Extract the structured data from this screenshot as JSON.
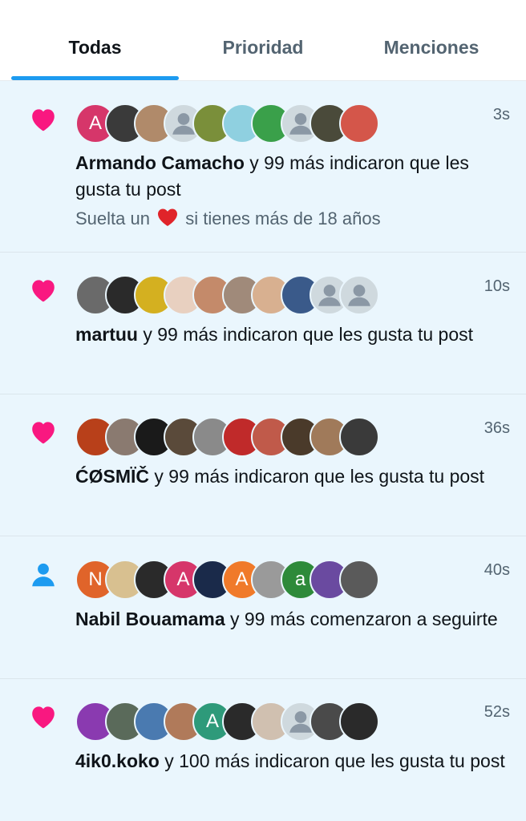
{
  "tabs": [
    {
      "label": "Todas",
      "active": true
    },
    {
      "label": "Prioridad",
      "active": false
    },
    {
      "label": "Menciones",
      "active": false
    }
  ],
  "colors": {
    "accent": "#1d9bf0",
    "like": "#f91880",
    "follow": "#1d9bf0",
    "background": "#eaf6fd"
  },
  "notifications": [
    {
      "type": "like",
      "icon": "heart-icon",
      "time": "3s",
      "name": "Armando Camacho",
      "action": "y 99 más indicaron que les gusta tu post",
      "post_preview_before": "Suelta un",
      "post_preview_emoji": "red-heart-emoji",
      "post_preview_after": "si tienes más de 18 años",
      "avatars": [
        {
          "letter": "A",
          "color": "#d6366a"
        },
        {
          "letter": "",
          "color": "#3a3a3a"
        },
        {
          "letter": "",
          "color": "#b08a6a"
        },
        {
          "letter": "",
          "color": "default"
        },
        {
          "letter": "",
          "color": "#7a8f3a"
        },
        {
          "letter": "",
          "color": "#8fd0e0"
        },
        {
          "letter": "",
          "color": "#3aa04a"
        },
        {
          "letter": "",
          "color": "default"
        },
        {
          "letter": "",
          "color": "#4a4a3a"
        },
        {
          "letter": "",
          "color": "#d4564a"
        }
      ]
    },
    {
      "type": "like",
      "icon": "heart-icon",
      "time": "10s",
      "name": "martuu",
      "action": "y 99 más indicaron que les gusta tu post",
      "avatars": [
        {
          "letter": "",
          "color": "#6a6a6a"
        },
        {
          "letter": "",
          "color": "#2a2a2a"
        },
        {
          "letter": "",
          "color": "#d4b020"
        },
        {
          "letter": "",
          "color": "#e8d0c0"
        },
        {
          "letter": "",
          "color": "#c48a6a"
        },
        {
          "letter": "",
          "color": "#a08a7a"
        },
        {
          "letter": "",
          "color": "#d8b090"
        },
        {
          "letter": "",
          "color": "#3a5a8a"
        },
        {
          "letter": "",
          "color": "default"
        },
        {
          "letter": "",
          "color": "default"
        }
      ]
    },
    {
      "type": "like",
      "icon": "heart-icon",
      "time": "36s",
      "name": "ĆØSMÏČ",
      "action": "y 99 más indicaron que les gusta tu post",
      "avatars": [
        {
          "letter": "",
          "color": "#b8401a"
        },
        {
          "letter": "",
          "color": "#8a7a70"
        },
        {
          "letter": "",
          "color": "#1a1a1a"
        },
        {
          "letter": "",
          "color": "#5a4a3a"
        },
        {
          "letter": "",
          "color": "#8a8a8a"
        },
        {
          "letter": "",
          "color": "#c02a2a"
        },
        {
          "letter": "",
          "color": "#c05a4a"
        },
        {
          "letter": "",
          "color": "#4a3a2a"
        },
        {
          "letter": "",
          "color": "#a07a5a"
        },
        {
          "letter": "",
          "color": "#3a3a3a"
        }
      ]
    },
    {
      "type": "follow",
      "icon": "person-icon",
      "time": "40s",
      "name": "Nabil Bouamama",
      "action": "y 99 más comenzaron a seguirte",
      "avatars": [
        {
          "letter": "N",
          "color": "#e0642a"
        },
        {
          "letter": "",
          "color": "#d8c090"
        },
        {
          "letter": "",
          "color": "#2a2a2a"
        },
        {
          "letter": "A",
          "color": "#d6366a"
        },
        {
          "letter": "",
          "color": "#1a2a4a"
        },
        {
          "letter": "A",
          "color": "#f07a2a"
        },
        {
          "letter": "",
          "color": "#9a9a9a"
        },
        {
          "letter": "a",
          "color": "#2e8a3a"
        },
        {
          "letter": "",
          "color": "#6a4aa0"
        },
        {
          "letter": "",
          "color": "#5a5a5a"
        }
      ]
    },
    {
      "type": "like",
      "icon": "heart-icon",
      "time": "52s",
      "name": "4ik0.koko",
      "action": "y 100 más indicaron que les gusta tu post",
      "avatars": [
        {
          "letter": "",
          "color": "#8a3ab0"
        },
        {
          "letter": "",
          "color": "#5a6a5a"
        },
        {
          "letter": "",
          "color": "#4a7ab0"
        },
        {
          "letter": "",
          "color": "#b07a5a"
        },
        {
          "letter": "A",
          "color": "#2e9a7a"
        },
        {
          "letter": "",
          "color": "#2a2a2a"
        },
        {
          "letter": "",
          "color": "#d0c0b0"
        },
        {
          "letter": "",
          "color": "default"
        },
        {
          "letter": "",
          "color": "#4a4a4a"
        },
        {
          "letter": "",
          "color": "#2a2a2a"
        }
      ]
    }
  ]
}
